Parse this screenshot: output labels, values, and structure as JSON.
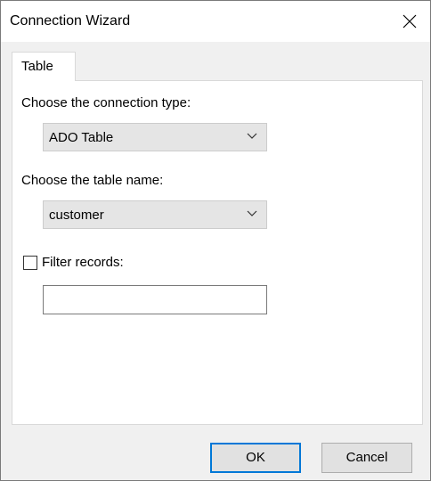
{
  "window": {
    "title": "Connection Wizard"
  },
  "tabs": [
    {
      "label": "Table"
    }
  ],
  "form": {
    "connection_type_label": "Choose the connection type:",
    "connection_type_value": "ADO Table",
    "table_name_label": "Choose the table name:",
    "table_name_value": "customer",
    "filter_label": "Filter records:",
    "filter_checked": false,
    "filter_value": ""
  },
  "buttons": {
    "ok": "OK",
    "cancel": "Cancel"
  },
  "icons": {
    "close": "close-icon",
    "dropdown": "chevron-down-icon"
  },
  "colors": {
    "default_button_border": "#0078d7"
  }
}
